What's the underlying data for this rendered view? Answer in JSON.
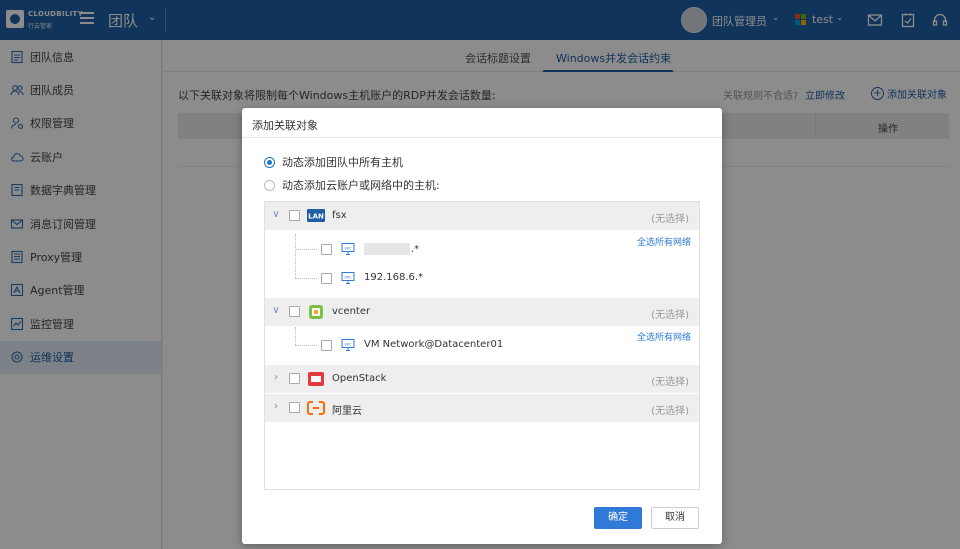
{
  "brand": {
    "name": "CLOUDBILITY",
    "sub": "行云管家"
  },
  "header": {
    "team_title": "团队",
    "user_name": "团队管理员",
    "tenant_name": "test",
    "caret": "⌄",
    "icons": [
      "mail-icon",
      "task-icon",
      "headset-icon"
    ]
  },
  "sidebar": {
    "items": [
      {
        "label": "团队信息",
        "icon": "team-info-icon"
      },
      {
        "label": "团队成员",
        "icon": "members-icon"
      },
      {
        "label": "权限管理",
        "icon": "permission-icon"
      },
      {
        "label": "云账户",
        "icon": "cloud-icon"
      },
      {
        "label": "数据字典管理",
        "icon": "dictionary-icon"
      },
      {
        "label": "消息订阅管理",
        "icon": "message-icon"
      },
      {
        "label": "Proxy管理",
        "icon": "proxy-icon"
      },
      {
        "label": "Agent管理",
        "icon": "agent-icon"
      },
      {
        "label": "监控管理",
        "icon": "monitor-icon"
      },
      {
        "label": "运维设置",
        "icon": "ops-icon",
        "active": true
      }
    ]
  },
  "main": {
    "tabs": [
      {
        "label": "会话标题设置"
      },
      {
        "label": "Windows并发会话约束",
        "active": true
      }
    ],
    "description": "以下关联对象将限制每个Windows主机账户的RDP并发会话数量:",
    "rule_question": "关联规则不合适?",
    "rule_link": "立即修改",
    "add_object": "添加关联对象",
    "table_action_header": "操作"
  },
  "modal": {
    "title": "添加关联对象",
    "radio_all": "动态添加团队中所有主机",
    "radio_specific": "动态添加云账户或网络中的主机:",
    "groups": [
      {
        "name": "fsx",
        "icon": "lan-icon",
        "status": "(无选择)",
        "expanded": true,
        "select_all": "全选所有网络",
        "children": [
          {
            "label": ".*",
            "masked": true
          },
          {
            "label": "192.168.6.*"
          }
        ]
      },
      {
        "name": "vcenter",
        "icon": "vcenter-icon",
        "status": "(无选择)",
        "expanded": true,
        "select_all": "全选所有网络",
        "children": [
          {
            "label": "VM Network@Datacenter01"
          }
        ]
      },
      {
        "name": "OpenStack",
        "icon": "openstack-icon",
        "status": "(无选择)",
        "expanded": false
      },
      {
        "name": "阿里云",
        "icon": "aliyun-icon",
        "status": "(无选择)",
        "expanded": false
      }
    ],
    "ok_label": "确定",
    "cancel_label": "取消"
  },
  "colors": {
    "header_bg": "#1f5fa6",
    "accent": "#2f7ad6",
    "sidebar_active": "#e3ecf7"
  }
}
